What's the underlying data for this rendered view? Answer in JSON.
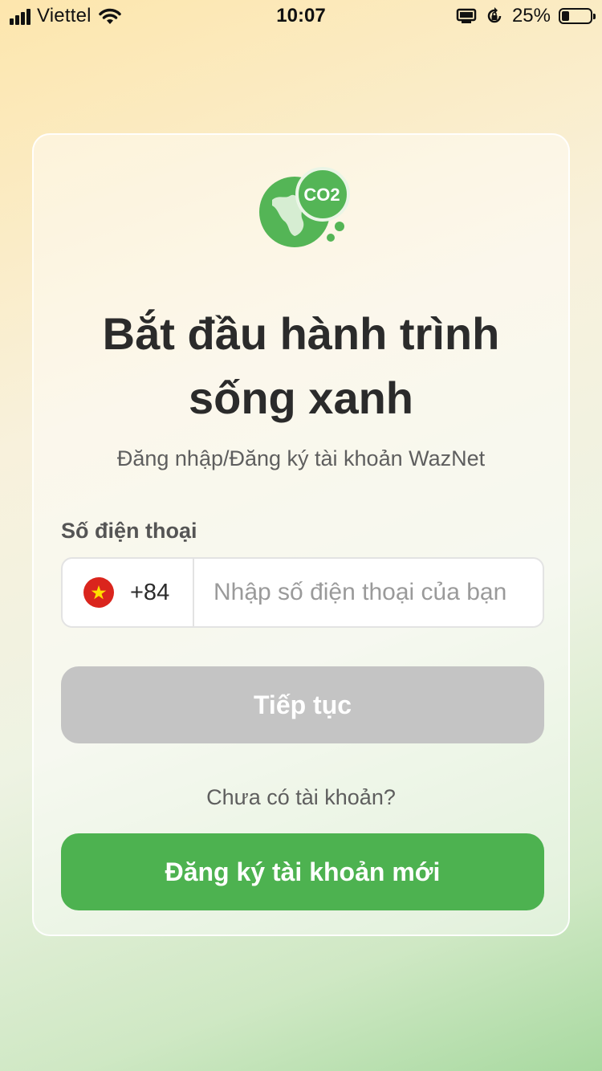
{
  "status_bar": {
    "carrier": "Viettel",
    "time": "10:07",
    "battery_percent": "25%",
    "battery_level": 0.25,
    "icons": [
      "signal-icon",
      "wifi-icon",
      "screen-mirror-icon",
      "orientation-lock-icon",
      "battery-icon"
    ]
  },
  "logo": {
    "text": "CO2",
    "icon": "earth-co2-icon",
    "color": "#4db250"
  },
  "login": {
    "title_line1": "Bắt đầu hành trình",
    "title_line2": "sống xanh",
    "subtitle": "Đăng nhập/Đăng ký tài khoản WazNet",
    "phone_label": "Số điện thoại",
    "country_code": "+84",
    "country_flag": "vietnam-flag-icon",
    "phone_value": "",
    "phone_placeholder": "Nhập số điện thoại của bạn",
    "continue_label": "Tiếp tục",
    "no_account_text": "Chưa có tài khoản?",
    "register_label": "Đăng ký tài khoản mới"
  },
  "colors": {
    "primary": "#4db250",
    "disabled": "#c4c4c4",
    "text_dark": "#2b2b2b",
    "text_muted": "#5e5e5e"
  }
}
